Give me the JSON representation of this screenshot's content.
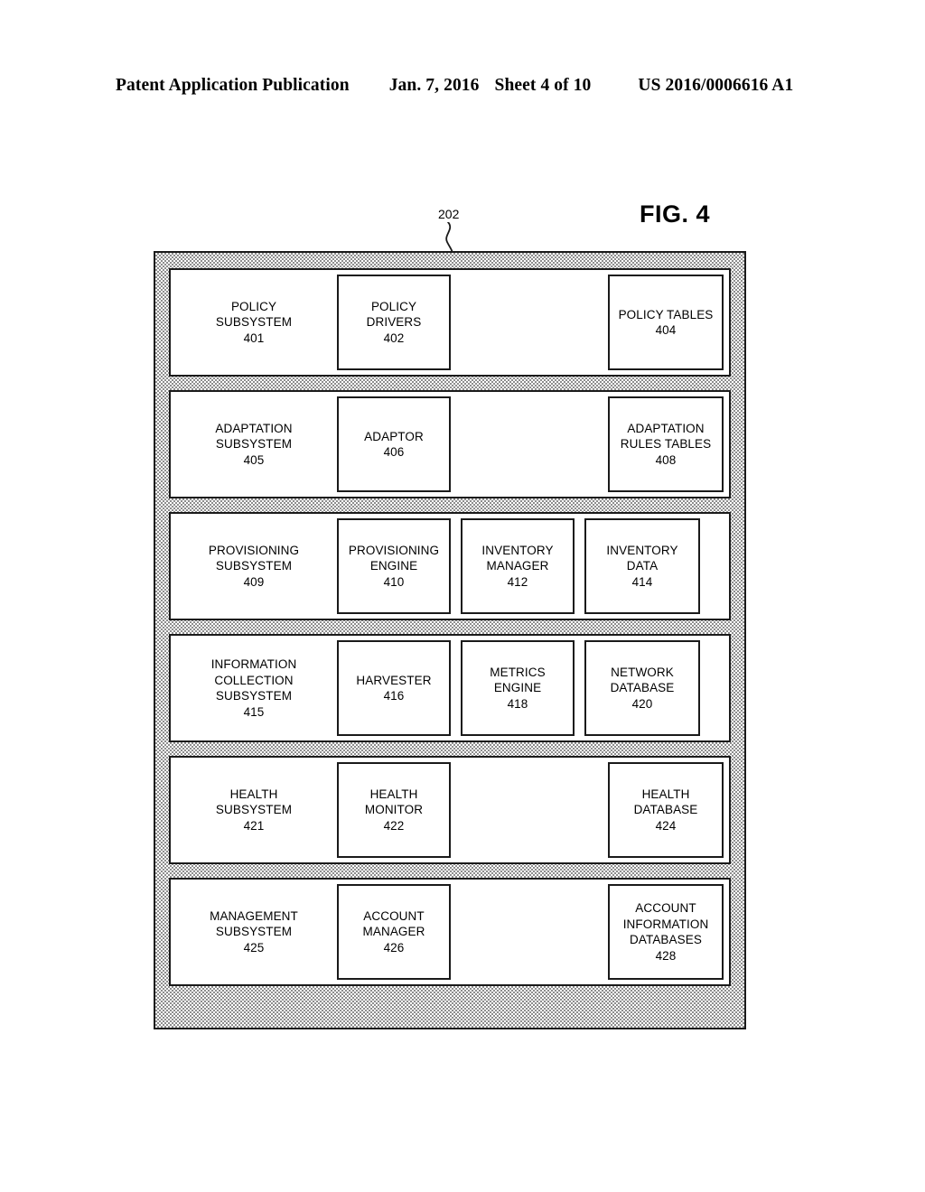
{
  "header": {
    "publication": "Patent Application Publication",
    "date": "Jan. 7, 2016",
    "sheet": "Sheet 4 of 10",
    "patent_number": "US 2016/0006616 A1"
  },
  "figure": {
    "label": "FIG. 4",
    "container_ref": "202"
  },
  "colors": {
    "line": "#1a1a1a",
    "hatch": "#8d8d8d",
    "background": "#ffffff"
  },
  "rows": [
    {
      "subsystem": {
        "lines": [
          "POLICY",
          "SUBSYSTEM",
          "401"
        ]
      },
      "components": [
        {
          "lines": [
            "POLICY",
            "DRIVERS",
            "402"
          ]
        },
        {
          "lines": [
            "POLICY TABLES",
            "404"
          ]
        }
      ]
    },
    {
      "subsystem": {
        "lines": [
          "ADAPTATION",
          "SUBSYSTEM",
          "405"
        ]
      },
      "components": [
        {
          "lines": [
            "ADAPTOR",
            "406"
          ]
        },
        {
          "lines": [
            "ADAPTATION",
            "RULES TABLES",
            "408"
          ]
        }
      ]
    },
    {
      "subsystem": {
        "lines": [
          "PROVISIONING",
          "SUBSYSTEM",
          "409"
        ]
      },
      "components": [
        {
          "lines": [
            "PROVISIONING",
            "ENGINE",
            "410"
          ]
        },
        {
          "lines": [
            "INVENTORY",
            "MANAGER",
            "412"
          ]
        },
        {
          "lines": [
            "INVENTORY",
            "DATA",
            "414"
          ]
        }
      ]
    },
    {
      "subsystem": {
        "lines": [
          "INFORMATION",
          "COLLECTION",
          "SUBSYSTEM",
          "415"
        ]
      },
      "components": [
        {
          "lines": [
            "HARVESTER",
            "416"
          ]
        },
        {
          "lines": [
            "METRICS",
            "ENGINE",
            "418"
          ]
        },
        {
          "lines": [
            "NETWORK",
            "DATABASE",
            "420"
          ]
        }
      ]
    },
    {
      "subsystem": {
        "lines": [
          "HEALTH",
          "SUBSYSTEM",
          "421"
        ]
      },
      "components": [
        {
          "lines": [
            "HEALTH",
            "MONITOR",
            "422"
          ]
        },
        {
          "lines": [
            "HEALTH",
            "DATABASE",
            "424"
          ]
        }
      ]
    },
    {
      "subsystem": {
        "lines": [
          "MANAGEMENT",
          "SUBSYSTEM",
          "425"
        ]
      },
      "components": [
        {
          "lines": [
            "ACCOUNT",
            "MANAGER",
            "426"
          ]
        },
        {
          "lines": [
            "ACCOUNT",
            "INFORMATION",
            "DATABASES",
            "428"
          ]
        }
      ]
    }
  ]
}
